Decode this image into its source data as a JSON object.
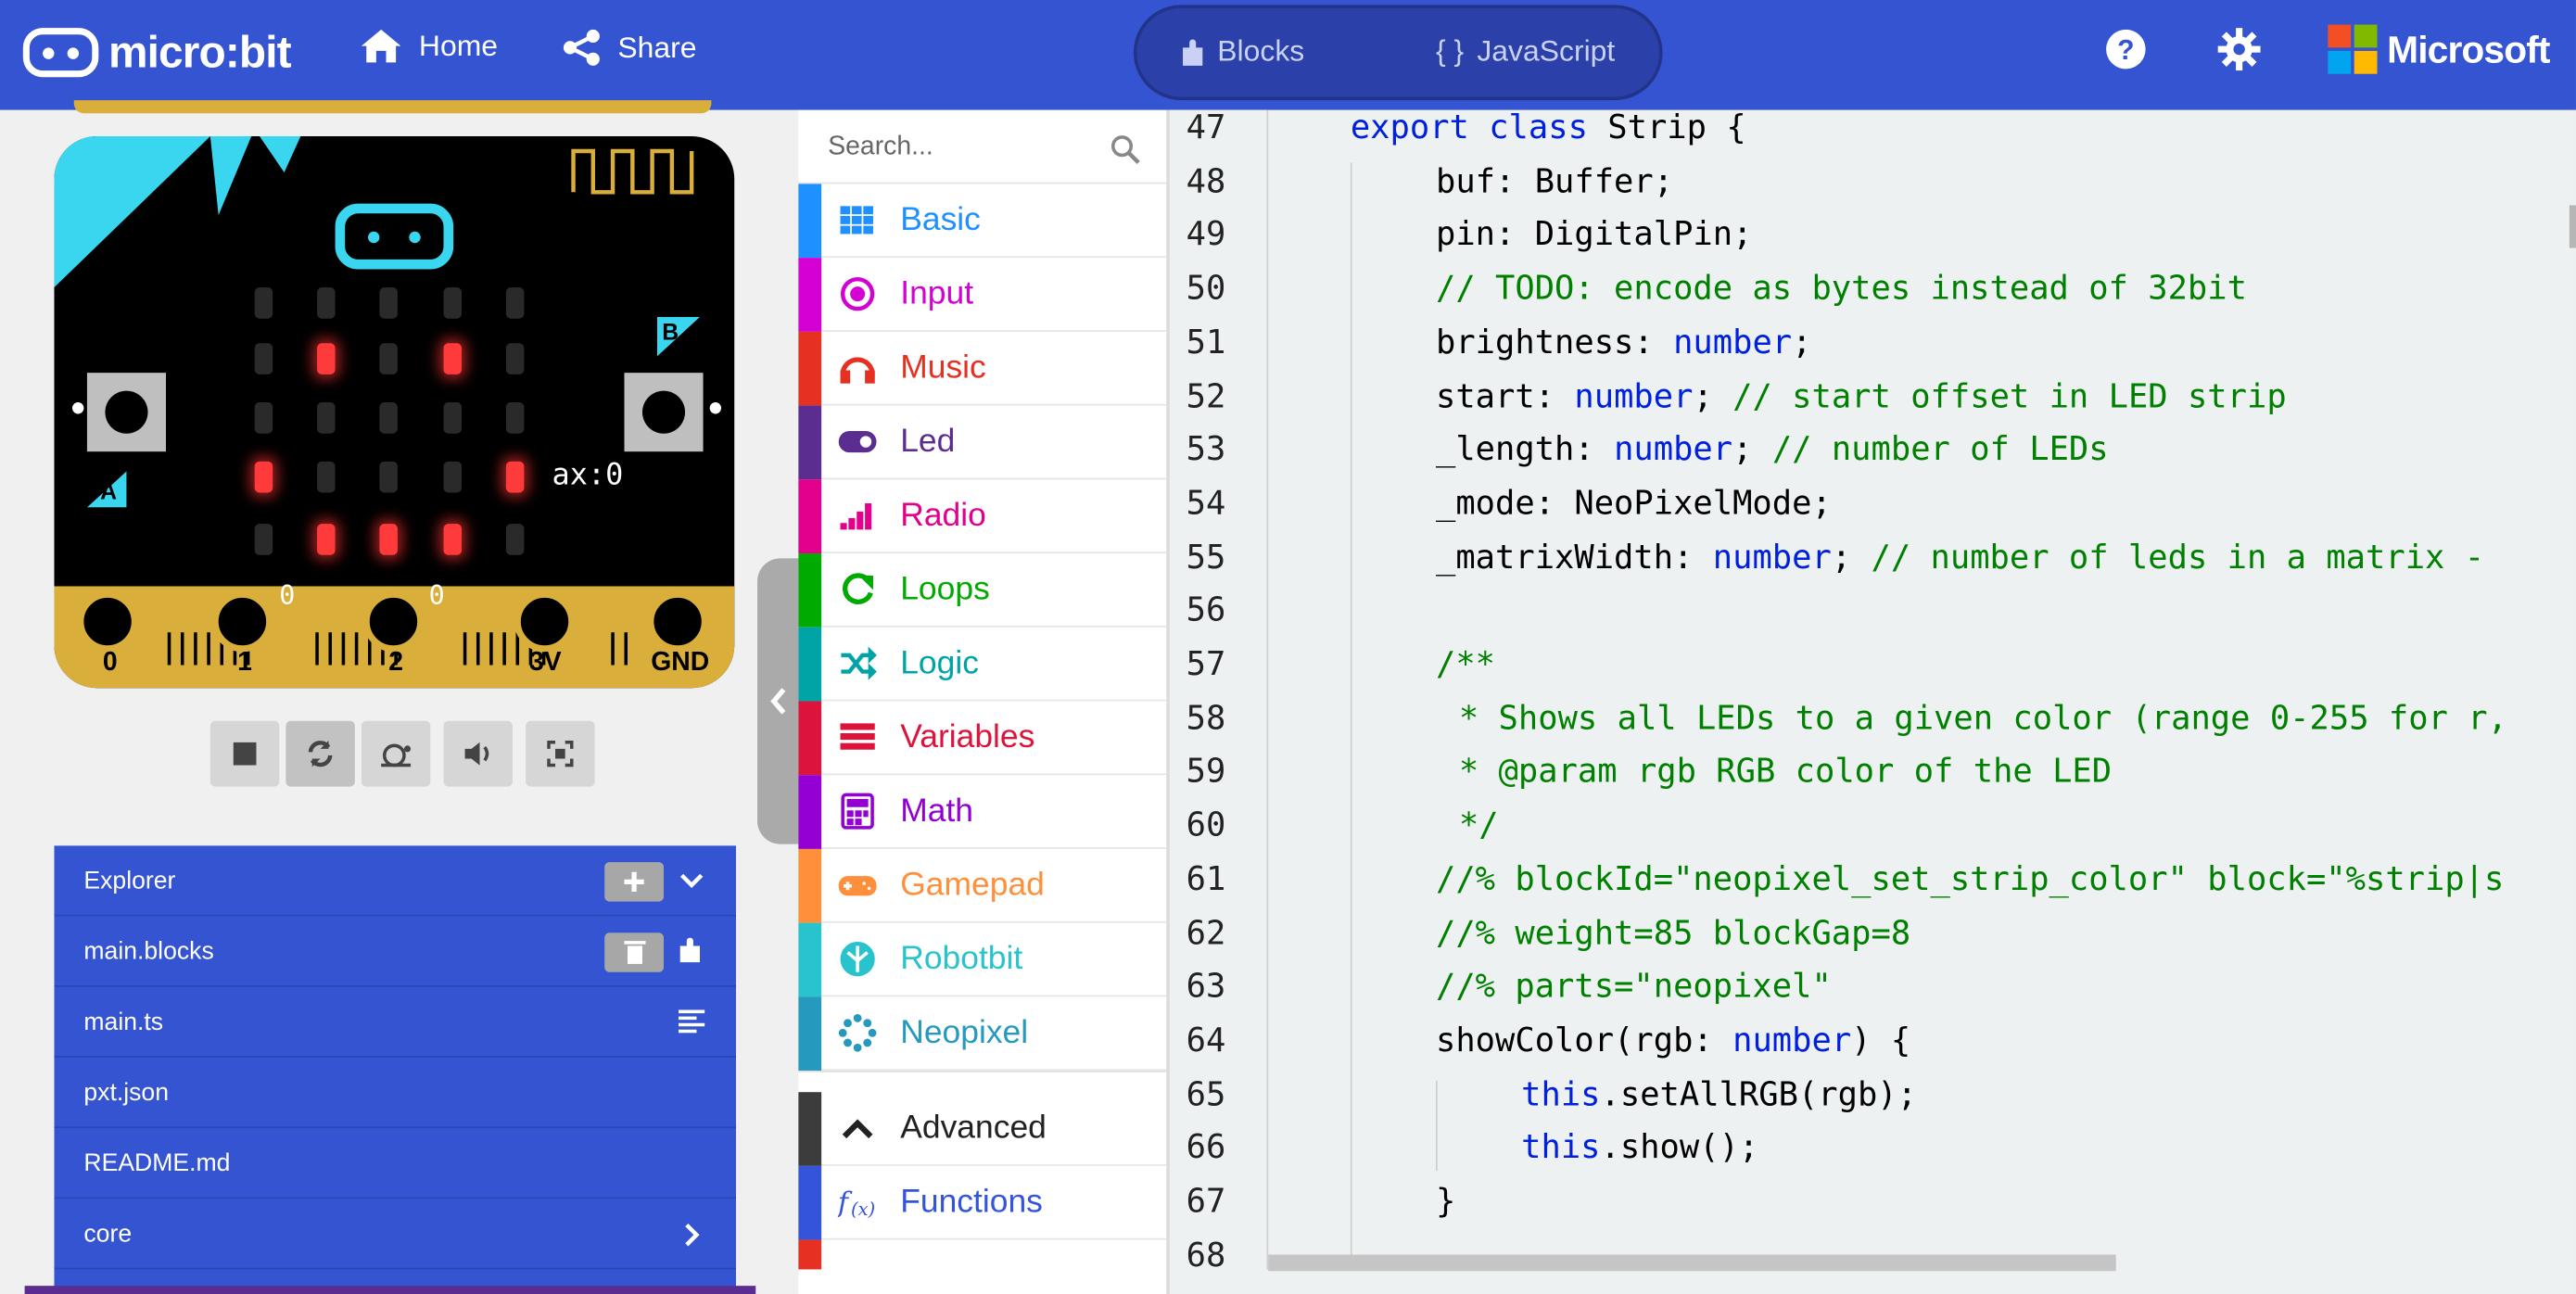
{
  "header": {
    "brand": "micro:bit",
    "home_label": "Home",
    "share_label": "Share",
    "tab_blocks": "Blocks",
    "tab_javascript": "JavaScript",
    "microsoft_label": "Microsoft",
    "icons": [
      "home-icon",
      "share-icon",
      "puzzle-icon",
      "braces-icon",
      "help-icon",
      "gear-icon"
    ],
    "colors": {
      "bar": "#3454D1"
    }
  },
  "simulator": {
    "button_a": "A",
    "button_b": "B",
    "pin_labels": [
      "0",
      "1",
      "2",
      "3V",
      "GND"
    ],
    "pin0_value": "0",
    "pin1_value": "0",
    "accel_readout": "ax:0",
    "led_matrix": [
      [
        0,
        0,
        0,
        0,
        0
      ],
      [
        0,
        1,
        0,
        1,
        0
      ],
      [
        0,
        0,
        0,
        0,
        0
      ],
      [
        1,
        0,
        0,
        0,
        1
      ],
      [
        0,
        1,
        1,
        1,
        0
      ]
    ],
    "controls": [
      "stop-icon",
      "restart-icon",
      "slow-mo-icon",
      "sound-icon",
      "fullscreen-icon"
    ]
  },
  "explorer": {
    "title": "Explorer",
    "files": [
      "main.blocks",
      "main.ts",
      "pxt.json",
      "README.md",
      "core"
    ]
  },
  "toolbox": {
    "search_placeholder": "Search...",
    "categories": [
      {
        "label": "Basic",
        "color": "#1e90ff"
      },
      {
        "label": "Input",
        "color": "#d400d4"
      },
      {
        "label": "Music",
        "color": "#e63022"
      },
      {
        "label": "Led",
        "color": "#5c2d91"
      },
      {
        "label": "Radio",
        "color": "#e3008c"
      },
      {
        "label": "Loops",
        "color": "#00aa00"
      },
      {
        "label": "Logic",
        "color": "#00a4a6"
      },
      {
        "label": "Variables",
        "color": "#dc143c"
      },
      {
        "label": "Math",
        "color": "#9400d3"
      },
      {
        "label": "Gamepad",
        "color": "#ff8f3a"
      },
      {
        "label": "Robotbit",
        "color": "#28c3cc"
      },
      {
        "label": "Neopixel",
        "color": "#2699bf"
      },
      {
        "label": "Advanced",
        "color": "#3c3c3c"
      },
      {
        "label": "Functions",
        "color": "#3455db"
      }
    ]
  },
  "editor": {
    "line_numbers": [
      "47",
      "48",
      "49",
      "50",
      "51",
      "52",
      "53",
      "54",
      "55",
      "56",
      "57",
      "58",
      "59",
      "60",
      "61",
      "62",
      "63",
      "64",
      "65",
      "66",
      "67",
      "68"
    ],
    "lines": [
      {
        "t": [
          [
            "kw",
            "export class "
          ],
          [
            "",
            "Strip {"
          ]
        ]
      },
      {
        "t": [
          [
            "",
            "buf: Buffer;"
          ]
        ]
      },
      {
        "t": [
          [
            "",
            "pin: DigitalPin;"
          ]
        ]
      },
      {
        "t": [
          [
            "cm",
            "// TODO: encode as bytes instead of 32bit"
          ]
        ]
      },
      {
        "t": [
          [
            "",
            "brightness: "
          ],
          [
            "kw",
            "number"
          ],
          [
            "",
            ";"
          ]
        ]
      },
      {
        "t": [
          [
            "",
            "start: "
          ],
          [
            "kw",
            "number"
          ],
          [
            "",
            "; "
          ],
          [
            "cm",
            "// start offset in LED strip"
          ]
        ]
      },
      {
        "t": [
          [
            "",
            "_length: "
          ],
          [
            "kw",
            "number"
          ],
          [
            "",
            "; "
          ],
          [
            "cm",
            "// number of LEDs"
          ]
        ]
      },
      {
        "t": [
          [
            "",
            "_mode: NeoPixelMode;"
          ]
        ]
      },
      {
        "t": [
          [
            "",
            "_matrixWidth: "
          ],
          [
            "kw",
            "number"
          ],
          [
            "",
            "; "
          ],
          [
            "cm",
            "// number of leds in a matrix - "
          ]
        ]
      },
      {
        "t": [
          [
            "",
            ""
          ]
        ]
      },
      {
        "t": [
          [
            "cm",
            "/**"
          ]
        ]
      },
      {
        "t": [
          [
            "cm",
            " * Shows all LEDs to a given color (range 0-255 for r, "
          ]
        ]
      },
      {
        "t": [
          [
            "cm",
            " * @param rgb RGB color of the LED"
          ]
        ]
      },
      {
        "t": [
          [
            "cm",
            " */"
          ]
        ]
      },
      {
        "t": [
          [
            "cm",
            "//% blockId=\"neopixel_set_strip_color\" block=\"%strip|s"
          ]
        ]
      },
      {
        "t": [
          [
            "cm",
            "//% weight=85 blockGap=8"
          ]
        ]
      },
      {
        "t": [
          [
            "cm",
            "//% parts=\"neopixel\""
          ]
        ]
      },
      {
        "t": [
          [
            "",
            "showColor(rgb: "
          ],
          [
            "kw",
            "number"
          ],
          [
            "",
            ") {"
          ]
        ]
      },
      {
        "t": [
          [
            "kw",
            "this"
          ],
          [
            "",
            ".setAllRGB(rgb);"
          ]
        ]
      },
      {
        "t": [
          [
            "kw",
            "this"
          ],
          [
            "",
            ".show();"
          ]
        ]
      },
      {
        "t": [
          [
            "",
            "}"
          ]
        ]
      },
      {
        "t": [
          [
            "",
            ""
          ]
        ]
      }
    ]
  }
}
